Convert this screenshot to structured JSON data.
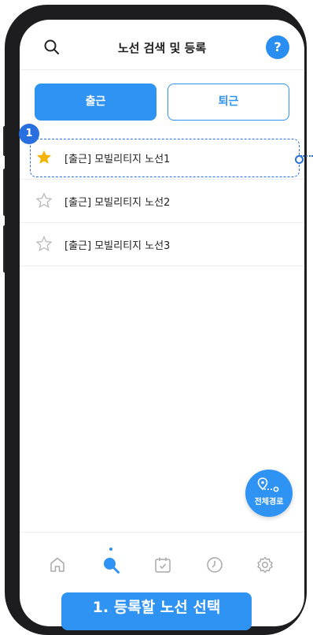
{
  "header": {
    "title": "노선 검색 및 등록",
    "help_label": "?"
  },
  "tabs": [
    {
      "label": "출근",
      "selected": true
    },
    {
      "label": "퇴근",
      "selected": false
    }
  ],
  "routes": [
    {
      "label": "[출근] 모빌리티지 노선1",
      "favorite": true
    },
    {
      "label": "[출근] 모빌리티지 노선2",
      "favorite": false
    },
    {
      "label": "[출근] 모빌리티지 노선3",
      "favorite": false
    }
  ],
  "step_badge": "1",
  "fab": {
    "label": "전체경로"
  },
  "bottom_nav": [
    {
      "icon": "home-icon",
      "active": false
    },
    {
      "icon": "search-icon",
      "active": true
    },
    {
      "icon": "calendar-check-icon",
      "active": false
    },
    {
      "icon": "clock-icon",
      "active": false
    },
    {
      "icon": "settings-icon",
      "active": false
    }
  ],
  "caption": "1. 등록할 노선 선택",
  "colors": {
    "primary": "#2f93f3",
    "annotation": "#2a6fe0",
    "star_active": "#f5b400",
    "star_inactive": "#b9b9b9"
  }
}
